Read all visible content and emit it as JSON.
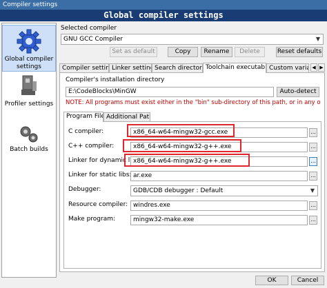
{
  "window": {
    "title": "Compiler settings",
    "banner": "Global compiler settings"
  },
  "sidebar": {
    "items": [
      {
        "label": "Global compiler settings",
        "icon": "gear-icon"
      },
      {
        "label": "Profiler settings",
        "icon": "profiler-icon"
      },
      {
        "label": "Batch builds",
        "icon": "batch-builds-icon"
      }
    ]
  },
  "selected_compiler": {
    "label": "Selected compiler",
    "value": "GNU GCC Compiler",
    "buttons": {
      "set_default": "Set as default",
      "copy": "Copy",
      "rename": "Rename",
      "delete": "Delete",
      "reset": "Reset defaults"
    }
  },
  "tabs": [
    "Compiler settings",
    "Linker settings",
    "Search directories",
    "Toolchain executables",
    "Custom variable"
  ],
  "install_dir": {
    "label": "Compiler's installation directory",
    "value": "E:\\CodeBlocks\\MinGW",
    "auto_detect": "Auto-detect",
    "note": "NOTE: All programs must exist either in the \"bin\" sub-directory of this path, or in any of the"
  },
  "subtabs": [
    "Program Files",
    "Additional Paths"
  ],
  "programs": [
    {
      "label": "C compiler:",
      "value": "x86_64-w64-mingw32-gcc.exe"
    },
    {
      "label": "C++ compiler:",
      "value": "x86_64-w64-mingw32-g++.exe"
    },
    {
      "label": "Linker for dynamic libs:",
      "value": "x86_64-w64-mingw32-g++.exe"
    },
    {
      "label": "Linker for static libs:",
      "value": "ar.exe"
    },
    {
      "label": "Debugger:",
      "value": "GDB/CDB debugger : Default"
    },
    {
      "label": "Resource compiler:",
      "value": "windres.exe"
    },
    {
      "label": "Make program:",
      "value": "mingw32-make.exe"
    }
  ],
  "dialog_buttons": {
    "ok": "OK",
    "cancel": "Cancel"
  },
  "colors": {
    "highlight_box": "#e0262c",
    "note_text": "#c00000",
    "banner_bg": "#1a3c74"
  }
}
